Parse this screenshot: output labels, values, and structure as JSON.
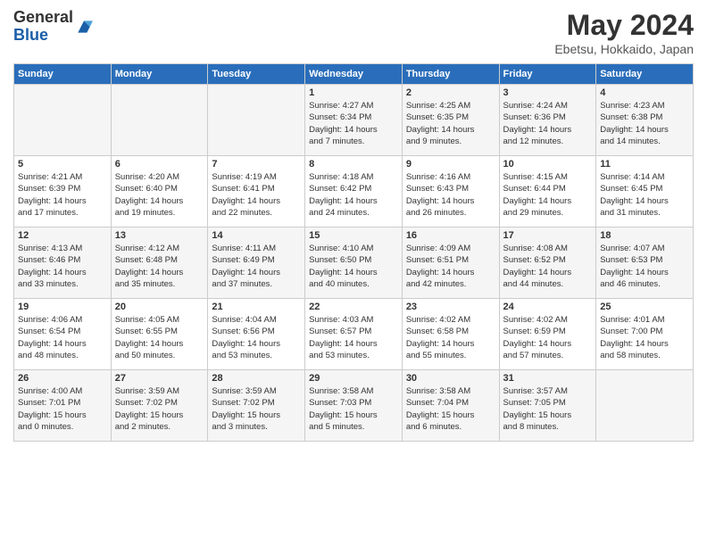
{
  "logo": {
    "general": "General",
    "blue": "Blue"
  },
  "title": "May 2024",
  "subtitle": "Ebetsu, Hokkaido, Japan",
  "headers": [
    "Sunday",
    "Monday",
    "Tuesday",
    "Wednesday",
    "Thursday",
    "Friday",
    "Saturday"
  ],
  "weeks": [
    [
      {
        "day": "",
        "info": ""
      },
      {
        "day": "",
        "info": ""
      },
      {
        "day": "",
        "info": ""
      },
      {
        "day": "1",
        "info": "Sunrise: 4:27 AM\nSunset: 6:34 PM\nDaylight: 14 hours\nand 7 minutes."
      },
      {
        "day": "2",
        "info": "Sunrise: 4:25 AM\nSunset: 6:35 PM\nDaylight: 14 hours\nand 9 minutes."
      },
      {
        "day": "3",
        "info": "Sunrise: 4:24 AM\nSunset: 6:36 PM\nDaylight: 14 hours\nand 12 minutes."
      },
      {
        "day": "4",
        "info": "Sunrise: 4:23 AM\nSunset: 6:38 PM\nDaylight: 14 hours\nand 14 minutes."
      }
    ],
    [
      {
        "day": "5",
        "info": "Sunrise: 4:21 AM\nSunset: 6:39 PM\nDaylight: 14 hours\nand 17 minutes."
      },
      {
        "day": "6",
        "info": "Sunrise: 4:20 AM\nSunset: 6:40 PM\nDaylight: 14 hours\nand 19 minutes."
      },
      {
        "day": "7",
        "info": "Sunrise: 4:19 AM\nSunset: 6:41 PM\nDaylight: 14 hours\nand 22 minutes."
      },
      {
        "day": "8",
        "info": "Sunrise: 4:18 AM\nSunset: 6:42 PM\nDaylight: 14 hours\nand 24 minutes."
      },
      {
        "day": "9",
        "info": "Sunrise: 4:16 AM\nSunset: 6:43 PM\nDaylight: 14 hours\nand 26 minutes."
      },
      {
        "day": "10",
        "info": "Sunrise: 4:15 AM\nSunset: 6:44 PM\nDaylight: 14 hours\nand 29 minutes."
      },
      {
        "day": "11",
        "info": "Sunrise: 4:14 AM\nSunset: 6:45 PM\nDaylight: 14 hours\nand 31 minutes."
      }
    ],
    [
      {
        "day": "12",
        "info": "Sunrise: 4:13 AM\nSunset: 6:46 PM\nDaylight: 14 hours\nand 33 minutes."
      },
      {
        "day": "13",
        "info": "Sunrise: 4:12 AM\nSunset: 6:48 PM\nDaylight: 14 hours\nand 35 minutes."
      },
      {
        "day": "14",
        "info": "Sunrise: 4:11 AM\nSunset: 6:49 PM\nDaylight: 14 hours\nand 37 minutes."
      },
      {
        "day": "15",
        "info": "Sunrise: 4:10 AM\nSunset: 6:50 PM\nDaylight: 14 hours\nand 40 minutes."
      },
      {
        "day": "16",
        "info": "Sunrise: 4:09 AM\nSunset: 6:51 PM\nDaylight: 14 hours\nand 42 minutes."
      },
      {
        "day": "17",
        "info": "Sunrise: 4:08 AM\nSunset: 6:52 PM\nDaylight: 14 hours\nand 44 minutes."
      },
      {
        "day": "18",
        "info": "Sunrise: 4:07 AM\nSunset: 6:53 PM\nDaylight: 14 hours\nand 46 minutes."
      }
    ],
    [
      {
        "day": "19",
        "info": "Sunrise: 4:06 AM\nSunset: 6:54 PM\nDaylight: 14 hours\nand 48 minutes."
      },
      {
        "day": "20",
        "info": "Sunrise: 4:05 AM\nSunset: 6:55 PM\nDaylight: 14 hours\nand 50 minutes."
      },
      {
        "day": "21",
        "info": "Sunrise: 4:04 AM\nSunset: 6:56 PM\nDaylight: 14 hours\nand 53 minutes."
      },
      {
        "day": "22",
        "info": "Sunrise: 4:03 AM\nSunset: 6:57 PM\nDaylight: 14 hours\nand 53 minutes."
      },
      {
        "day": "23",
        "info": "Sunrise: 4:02 AM\nSunset: 6:58 PM\nDaylight: 14 hours\nand 55 minutes."
      },
      {
        "day": "24",
        "info": "Sunrise: 4:02 AM\nSunset: 6:59 PM\nDaylight: 14 hours\nand 57 minutes."
      },
      {
        "day": "25",
        "info": "Sunrise: 4:01 AM\nSunset: 7:00 PM\nDaylight: 14 hours\nand 58 minutes."
      }
    ],
    [
      {
        "day": "26",
        "info": "Sunrise: 4:00 AM\nSunset: 7:01 PM\nDaylight: 15 hours\nand 0 minutes."
      },
      {
        "day": "27",
        "info": "Sunrise: 3:59 AM\nSunset: 7:02 PM\nDaylight: 15 hours\nand 2 minutes."
      },
      {
        "day": "28",
        "info": "Sunrise: 3:59 AM\nSunset: 7:02 PM\nDaylight: 15 hours\nand 3 minutes."
      },
      {
        "day": "29",
        "info": "Sunrise: 3:58 AM\nSunset: 7:03 PM\nDaylight: 15 hours\nand 5 minutes."
      },
      {
        "day": "30",
        "info": "Sunrise: 3:58 AM\nSunset: 7:04 PM\nDaylight: 15 hours\nand 6 minutes."
      },
      {
        "day": "31",
        "info": "Sunrise: 3:57 AM\nSunset: 7:05 PM\nDaylight: 15 hours\nand 8 minutes."
      },
      {
        "day": "",
        "info": ""
      }
    ]
  ]
}
